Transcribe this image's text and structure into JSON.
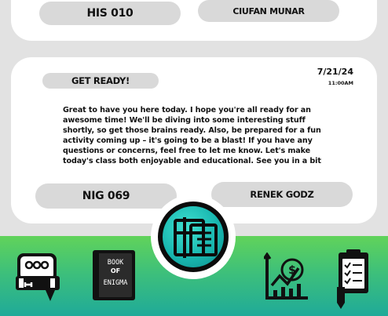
{
  "previous_post": {
    "course_code": "HIS 010",
    "author": "CIUFAN MUNAR"
  },
  "post": {
    "title": "GET READY!",
    "date": "7/21/24",
    "time": "11:00AM",
    "body": "Great to have you here today. I hope you're all ready for an awesome time! We'll be diving into some interesting stuff shortly, so get those brains ready. Also, be prepared for a fun activity coming up – it's going to be a blast! If you have any questions or concerns, feel free to let me know. Let's make today's class both enjoyable and educational. See you in a bit",
    "course_code": "NIG 069",
    "author": "RENEK GODZ"
  },
  "nav": {
    "book_icon_text": [
      "BOOK",
      "OF",
      "ENIGMA"
    ],
    "items": [
      {
        "icon": "chat-h-icon"
      },
      {
        "icon": "book-of-enigma-icon"
      },
      {
        "icon": "home-news-icon"
      },
      {
        "icon": "stats-chart-icon"
      },
      {
        "icon": "clipboard-pen-icon"
      }
    ]
  },
  "colors": {
    "background": "#e2e2e2",
    "card": "#ffffff",
    "pill": "#d9d9d9",
    "bar_top": "#61d35a",
    "bar_bottom": "#1faa99",
    "center_accent": "#19b7b0"
  }
}
